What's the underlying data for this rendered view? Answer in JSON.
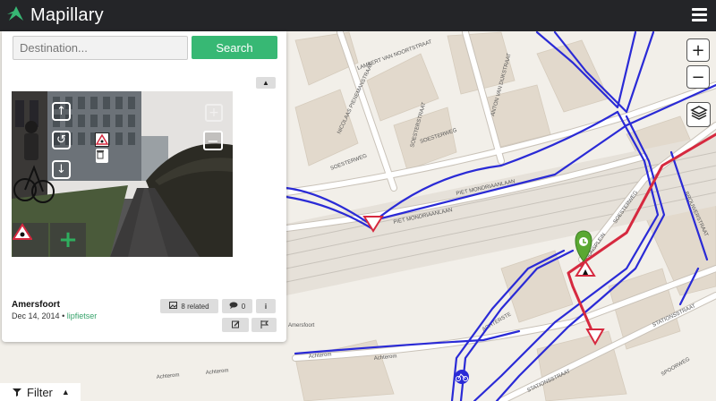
{
  "app": {
    "name": "Mapillary"
  },
  "search": {
    "placeholder": "Destination...",
    "value": "",
    "button_label": "Search"
  },
  "map": {
    "zoom_in_label": "+",
    "zoom_out_label": "−",
    "street_labels": [
      "SOESTERWEG",
      "SOESTERWEG",
      "LAMBERT VAN NOORTSTRAAT",
      "NICOLAAS PIENEMANSTRAAT",
      "SOESTERSTRAAT",
      "ANTON VAN DIJKSTRAAT",
      "PIET MONDRIAANLAAN",
      "PIET MONDRIAANLAAN",
      "STATIONSSTRAAT",
      "STATIONSSTRAAT",
      "BROUWERSTRAAT",
      "STATIONSPLEIN",
      "SPOORWEG",
      "ACHTERSTE",
      "Achterom",
      "Achterom",
      "Amersfoort",
      "Achterom",
      "Achterom",
      "SOESTERWEG"
    ],
    "colors": {
      "sequence": "#2a2ad6",
      "active_sequence": "#d6293f",
      "marker": "#5aa832"
    }
  },
  "viewer": {
    "zoom_in_label": "+",
    "zoom_out_label": "−"
  },
  "location": {
    "title": "Amersfoort",
    "date": "Dec 14, 2014",
    "separator": "•",
    "user": "lipfietser",
    "related_label": "8 related",
    "comment_count": "0",
    "info_label": "i"
  },
  "filter": {
    "label": "Filter"
  },
  "icons": [
    "mapillary-logo-icon",
    "hamburger-icon",
    "layers-icon",
    "arrow-up-icon",
    "rotate-icon",
    "arrow-down-icon",
    "warning-sign-icon",
    "trash-icon",
    "plus-icon",
    "image-icon",
    "comment-icon",
    "edit-icon",
    "flag-icon",
    "filter-icon",
    "chevron-up-icon",
    "bicycle-icon"
  ]
}
